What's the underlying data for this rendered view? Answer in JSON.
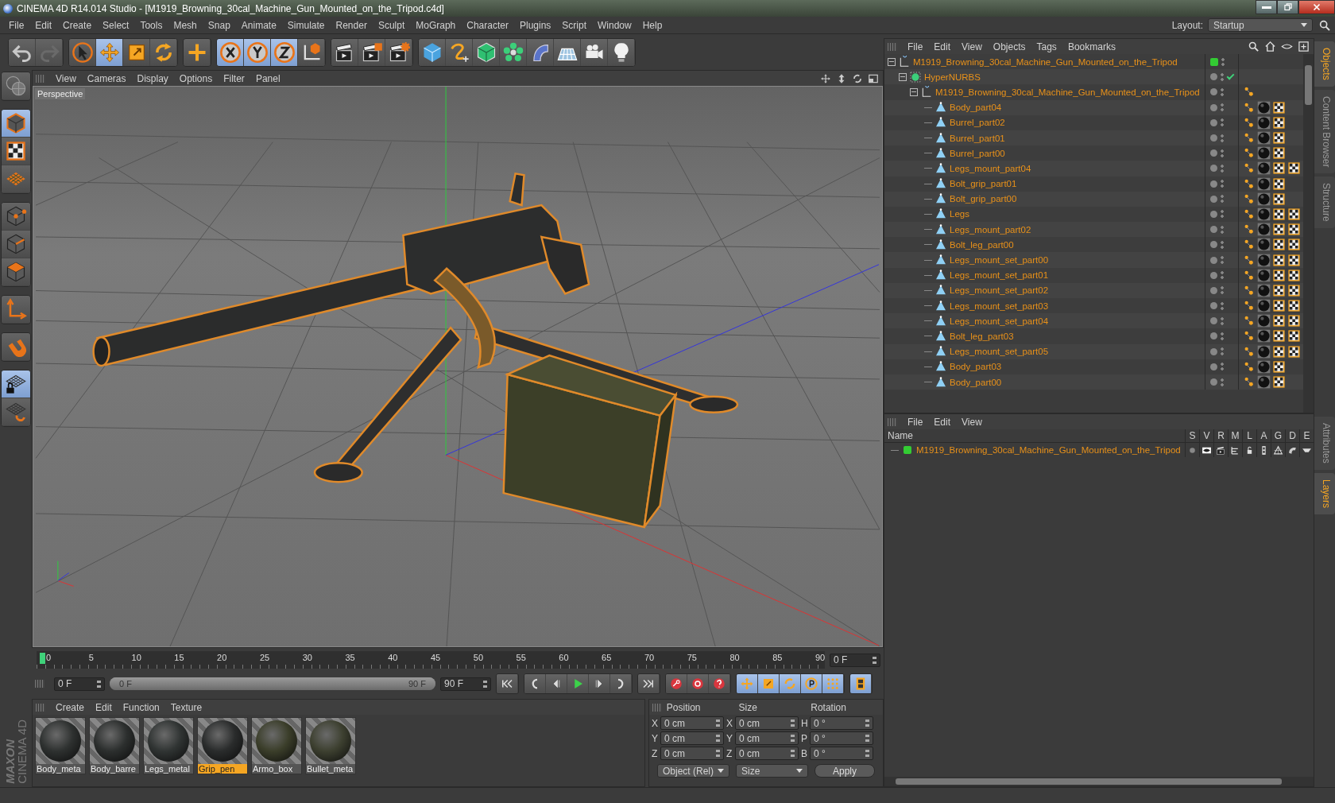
{
  "window": {
    "title": "CINEMA 4D R14.014 Studio - [M1919_Browning_30cal_Machine_Gun_Mounted_on_the_Tripod.c4d]"
  },
  "menu": [
    "File",
    "Edit",
    "Create",
    "Select",
    "Tools",
    "Mesh",
    "Snap",
    "Animate",
    "Simulate",
    "Render",
    "Sculpt",
    "MoGraph",
    "Character",
    "Plugins",
    "Script",
    "Window",
    "Help"
  ],
  "layout": {
    "label": "Layout:",
    "value": "Startup"
  },
  "toolbar": [
    [
      {
        "kind": "undo",
        "selected": false
      },
      {
        "kind": "redo",
        "selected": false
      }
    ],
    [
      {
        "kind": "select",
        "selected": false
      },
      {
        "kind": "move",
        "selected": true
      },
      {
        "kind": "scale",
        "selected": false
      },
      {
        "kind": "rotate",
        "selected": false
      }
    ],
    [
      {
        "kind": "add",
        "selected": false
      }
    ],
    [
      {
        "kind": "axis_x",
        "selected": true
      },
      {
        "kind": "axis_y",
        "selected": true
      },
      {
        "kind": "axis_z",
        "selected": true
      },
      {
        "kind": "coords",
        "selected": false
      }
    ],
    [
      {
        "kind": "render_view",
        "selected": false
      },
      {
        "kind": "render_picture",
        "selected": false
      },
      {
        "kind": "render_settings",
        "selected": false
      }
    ],
    [
      {
        "kind": "cube",
        "selected": false
      },
      {
        "kind": "spline",
        "selected": false
      },
      {
        "kind": "nurbs",
        "selected": false
      },
      {
        "kind": "array",
        "selected": false
      },
      {
        "kind": "deformer",
        "selected": false
      },
      {
        "kind": "floor",
        "selected": false
      },
      {
        "kind": "camera",
        "selected": false
      },
      {
        "kind": "light",
        "selected": false
      }
    ]
  ],
  "left_tools": [
    [
      {
        "kind": "nav",
        "selected": false
      }
    ],
    [
      {
        "kind": "model",
        "selected": true
      },
      {
        "kind": "texture",
        "selected": false
      },
      {
        "kind": "workplane",
        "selected": false
      }
    ],
    [
      {
        "kind": "points",
        "selected": false
      },
      {
        "kind": "edges",
        "selected": false
      },
      {
        "kind": "polygons",
        "selected": false
      }
    ],
    [
      {
        "kind": "axis",
        "selected": false
      }
    ],
    [
      {
        "kind": "magnet",
        "selected": false
      }
    ],
    [
      {
        "kind": "workplane_lock",
        "selected": true
      },
      {
        "kind": "workplane_rotate",
        "selected": false
      }
    ]
  ],
  "brand": {
    "company": "MAXON",
    "product": "CINEMA 4D"
  },
  "viewport": {
    "menu": [
      "View",
      "Cameras",
      "Display",
      "Options",
      "Filter",
      "Panel"
    ],
    "label": "Perspective"
  },
  "timeline": {
    "ticks": [
      "0",
      "5",
      "10",
      "15",
      "20",
      "25",
      "30",
      "35",
      "40",
      "45",
      "50",
      "55",
      "60",
      "65",
      "70",
      "75",
      "80",
      "85",
      "90"
    ],
    "level": 0,
    "current": "0 F"
  },
  "transport": {
    "start": "0 F",
    "range": {
      "start": "0 F",
      "end": "90 F",
      "level": 1
    },
    "end": "90 F",
    "buttons": [
      {
        "kind": "first"
      },
      {
        "kind": "prev_key"
      },
      {
        "kind": "prev"
      },
      {
        "kind": "play"
      },
      {
        "kind": "next"
      },
      {
        "kind": "next_key"
      },
      {
        "kind": "last"
      },
      {
        "kind": "record"
      },
      {
        "kind": "autokey"
      },
      {
        "kind": "key_help"
      },
      {
        "kind": "key_move"
      },
      {
        "kind": "key_scale"
      },
      {
        "kind": "key_rotate"
      },
      {
        "kind": "key_param"
      },
      {
        "kind": "key_points"
      },
      {
        "kind": "film"
      }
    ]
  },
  "materials": {
    "menu": [
      "Create",
      "Edit",
      "Function",
      "Texture"
    ],
    "items": [
      {
        "name": "Body_meta",
        "color": "#2e3130",
        "selected": false
      },
      {
        "name": "Body_barre",
        "color": "#2c2f2e",
        "selected": false
      },
      {
        "name": "Legs_metal",
        "color": "#303433",
        "selected": false
      },
      {
        "name": "Grip_pen",
        "color": "#2a2c2c",
        "selected": true
      },
      {
        "name": "Armo_box",
        "color": "#3b3e2a",
        "selected": false
      },
      {
        "name": "Bullet_meta",
        "color": "#3d4030",
        "selected": false
      }
    ]
  },
  "coordinates": {
    "headers": [
      "Position",
      "Size",
      "Rotation"
    ],
    "rows": [
      {
        "pos_axis": "X",
        "pos": "0 cm",
        "size_axis": "X",
        "size": "0 cm",
        "rot_axis": "H",
        "rot": "0 °"
      },
      {
        "pos_axis": "Y",
        "pos": "0 cm",
        "size_axis": "Y",
        "size": "0 cm",
        "rot_axis": "P",
        "rot": "0 °"
      },
      {
        "pos_axis": "Z",
        "pos": "0 cm",
        "size_axis": "Z",
        "size": "0 cm",
        "rot_axis": "B",
        "rot": "0 °"
      }
    ],
    "mode": "Object (Rel)",
    "size_mode": "Size",
    "apply": "Apply"
  },
  "objects": {
    "menu": [
      "File",
      "Edit",
      "View",
      "Objects",
      "Tags",
      "Bookmarks"
    ],
    "tree": [
      {
        "name": "M1919_Browning_30cal_Machine_Gun_Mounted_on_the_Tripod",
        "kind": "null",
        "expanded": true,
        "color": "#33cc33",
        "children": [
          {
            "name": "HyperNURBS",
            "kind": "hypernurbs",
            "expanded": true,
            "enabled": true,
            "children": [
              {
                "name": "M1919_Browning_30cal_Machine_Gun_Mounted_on_the_Tripod",
                "kind": "null",
                "expanded": true,
                "tags": [
                  {
                    "kind": "phong"
                  }
                ],
                "children": [
                  {
                    "name": "Body_part04",
                    "kind": "polygon",
                    "tags": [
                      {
                        "kind": "phong"
                      },
                      {
                        "kind": "material"
                      },
                      {
                        "kind": "texture"
                      }
                    ]
                  },
                  {
                    "name": "Burrel_part02",
                    "kind": "polygon",
                    "tags": [
                      {
                        "kind": "phong"
                      },
                      {
                        "kind": "material"
                      },
                      {
                        "kind": "texture"
                      }
                    ]
                  },
                  {
                    "name": "Burrel_part01",
                    "kind": "polygon",
                    "tags": [
                      {
                        "kind": "phong"
                      },
                      {
                        "kind": "material"
                      },
                      {
                        "kind": "texture"
                      }
                    ]
                  },
                  {
                    "name": "Burrel_part00",
                    "kind": "polygon",
                    "tags": [
                      {
                        "kind": "phong"
                      },
                      {
                        "kind": "material"
                      },
                      {
                        "kind": "texture"
                      }
                    ]
                  },
                  {
                    "name": "Legs_mount_part04",
                    "kind": "polygon",
                    "tags": [
                      {
                        "kind": "phong"
                      },
                      {
                        "kind": "material"
                      },
                      {
                        "kind": "texture"
                      },
                      {
                        "kind": "texture"
                      }
                    ]
                  },
                  {
                    "name": "Bolt_grip_part01",
                    "kind": "polygon",
                    "tags": [
                      {
                        "kind": "phong"
                      },
                      {
                        "kind": "material"
                      },
                      {
                        "kind": "texture"
                      }
                    ]
                  },
                  {
                    "name": "Bolt_grip_part00",
                    "kind": "polygon",
                    "tags": [
                      {
                        "kind": "phong"
                      },
                      {
                        "kind": "material"
                      },
                      {
                        "kind": "texture"
                      }
                    ]
                  },
                  {
                    "name": "Legs",
                    "kind": "polygon",
                    "tags": [
                      {
                        "kind": "phong"
                      },
                      {
                        "kind": "material"
                      },
                      {
                        "kind": "texture"
                      },
                      {
                        "kind": "texture"
                      }
                    ]
                  },
                  {
                    "name": "Legs_mount_part02",
                    "kind": "polygon",
                    "tags": [
                      {
                        "kind": "phong"
                      },
                      {
                        "kind": "material"
                      },
                      {
                        "kind": "texture"
                      },
                      {
                        "kind": "texture"
                      }
                    ]
                  },
                  {
                    "name": "Bolt_leg_part00",
                    "kind": "polygon",
                    "tags": [
                      {
                        "kind": "phong"
                      },
                      {
                        "kind": "material"
                      },
                      {
                        "kind": "texture"
                      },
                      {
                        "kind": "texture"
                      }
                    ]
                  },
                  {
                    "name": "Legs_mount_set_part00",
                    "kind": "polygon",
                    "tags": [
                      {
                        "kind": "phong"
                      },
                      {
                        "kind": "material"
                      },
                      {
                        "kind": "texture"
                      },
                      {
                        "kind": "texture"
                      }
                    ]
                  },
                  {
                    "name": "Legs_mount_set_part01",
                    "kind": "polygon",
                    "tags": [
                      {
                        "kind": "phong"
                      },
                      {
                        "kind": "material"
                      },
                      {
                        "kind": "texture"
                      },
                      {
                        "kind": "texture"
                      }
                    ]
                  },
                  {
                    "name": "Legs_mount_set_part02",
                    "kind": "polygon",
                    "tags": [
                      {
                        "kind": "phong"
                      },
                      {
                        "kind": "material"
                      },
                      {
                        "kind": "texture"
                      },
                      {
                        "kind": "texture"
                      }
                    ]
                  },
                  {
                    "name": "Legs_mount_set_part03",
                    "kind": "polygon",
                    "tags": [
                      {
                        "kind": "phong"
                      },
                      {
                        "kind": "material"
                      },
                      {
                        "kind": "texture"
                      },
                      {
                        "kind": "texture"
                      }
                    ]
                  },
                  {
                    "name": "Legs_mount_set_part04",
                    "kind": "polygon",
                    "tags": [
                      {
                        "kind": "phong"
                      },
                      {
                        "kind": "material"
                      },
                      {
                        "kind": "texture"
                      },
                      {
                        "kind": "texture"
                      }
                    ]
                  },
                  {
                    "name": "Bolt_leg_part03",
                    "kind": "polygon",
                    "tags": [
                      {
                        "kind": "phong"
                      },
                      {
                        "kind": "material"
                      },
                      {
                        "kind": "texture"
                      },
                      {
                        "kind": "texture"
                      }
                    ]
                  },
                  {
                    "name": "Legs_mount_set_part05",
                    "kind": "polygon",
                    "tags": [
                      {
                        "kind": "phong"
                      },
                      {
                        "kind": "material"
                      },
                      {
                        "kind": "texture"
                      },
                      {
                        "kind": "texture"
                      }
                    ]
                  },
                  {
                    "name": "Body_part03",
                    "kind": "polygon",
                    "tags": [
                      {
                        "kind": "phong"
                      },
                      {
                        "kind": "material"
                      },
                      {
                        "kind": "texture"
                      }
                    ]
                  },
                  {
                    "name": "Body_part00",
                    "kind": "polygon",
                    "tags": [
                      {
                        "kind": "phong"
                      },
                      {
                        "kind": "material"
                      },
                      {
                        "kind": "texture"
                      }
                    ]
                  }
                ]
              }
            ]
          }
        ]
      }
    ]
  },
  "side_tabs_top": [
    {
      "label": "Objects",
      "selected": true
    },
    {
      "label": "Content Browser",
      "selected": false
    },
    {
      "label": "Structure",
      "selected": false
    }
  ],
  "layers": {
    "menu": [
      "File",
      "Edit",
      "View"
    ],
    "columns": [
      "Name",
      "S",
      "V",
      "R",
      "M",
      "L",
      "A",
      "G",
      "D",
      "E"
    ],
    "rows": [
      {
        "name": "M1919_Browning_30cal_Machine_Gun_Mounted_on_the_Tripod",
        "color": "#33cc33"
      }
    ]
  },
  "side_tabs_bottom": [
    {
      "label": "Attributes",
      "selected": false
    },
    {
      "label": "Layers",
      "selected": true
    }
  ]
}
